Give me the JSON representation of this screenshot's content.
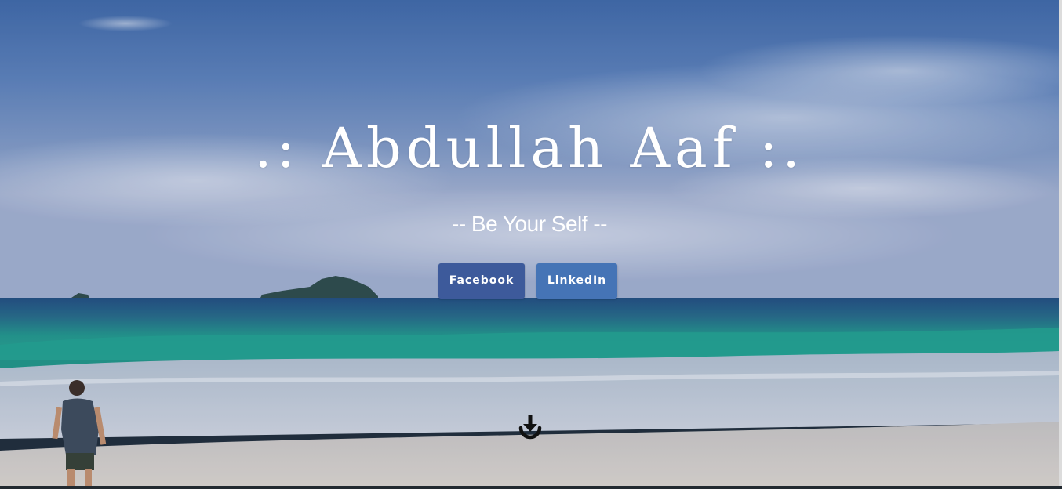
{
  "hero": {
    "title": ".: Abdullah Aaf :.",
    "subtitle": "-- Be Your Self --"
  },
  "buttons": {
    "facebook_label": "Facebook",
    "linkedin_label": "LinkedIn",
    "facebook_color": "#3d5a9b",
    "linkedin_color": "#4574b6"
  },
  "scroll_icon": "download-arrow-icon"
}
